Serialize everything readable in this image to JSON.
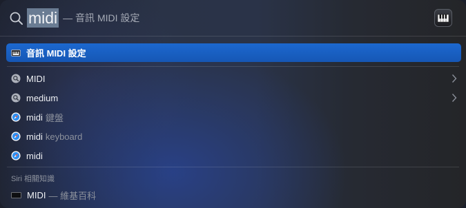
{
  "search": {
    "query": "midi",
    "suggestion": "— 音訊 MIDI 設定",
    "app_icon": "piano-keyboard-icon"
  },
  "top_hit": {
    "label": "音訊 MIDI 設定",
    "icon": "piano-keyboard-icon",
    "highlight_color": "#1a62c6"
  },
  "results": [
    {
      "label": "MIDI",
      "secondary": "",
      "icon": "search-icon",
      "has_chevron": true
    },
    {
      "label": "medium",
      "secondary": "",
      "icon": "search-icon",
      "has_chevron": true
    },
    {
      "label": "midi",
      "secondary": "鍵盤",
      "icon": "safari-compass-icon",
      "has_chevron": false
    },
    {
      "label": "midi",
      "secondary": "keyboard",
      "icon": "safari-compass-icon",
      "has_chevron": false
    },
    {
      "label": "midi",
      "secondary": "",
      "icon": "safari-compass-icon",
      "has_chevron": false
    }
  ],
  "siri_section": {
    "title": "Siri 相關知識",
    "item": {
      "label": "MIDI",
      "secondary": "— 維基百科",
      "icon": "midi-logo-icon"
    }
  }
}
